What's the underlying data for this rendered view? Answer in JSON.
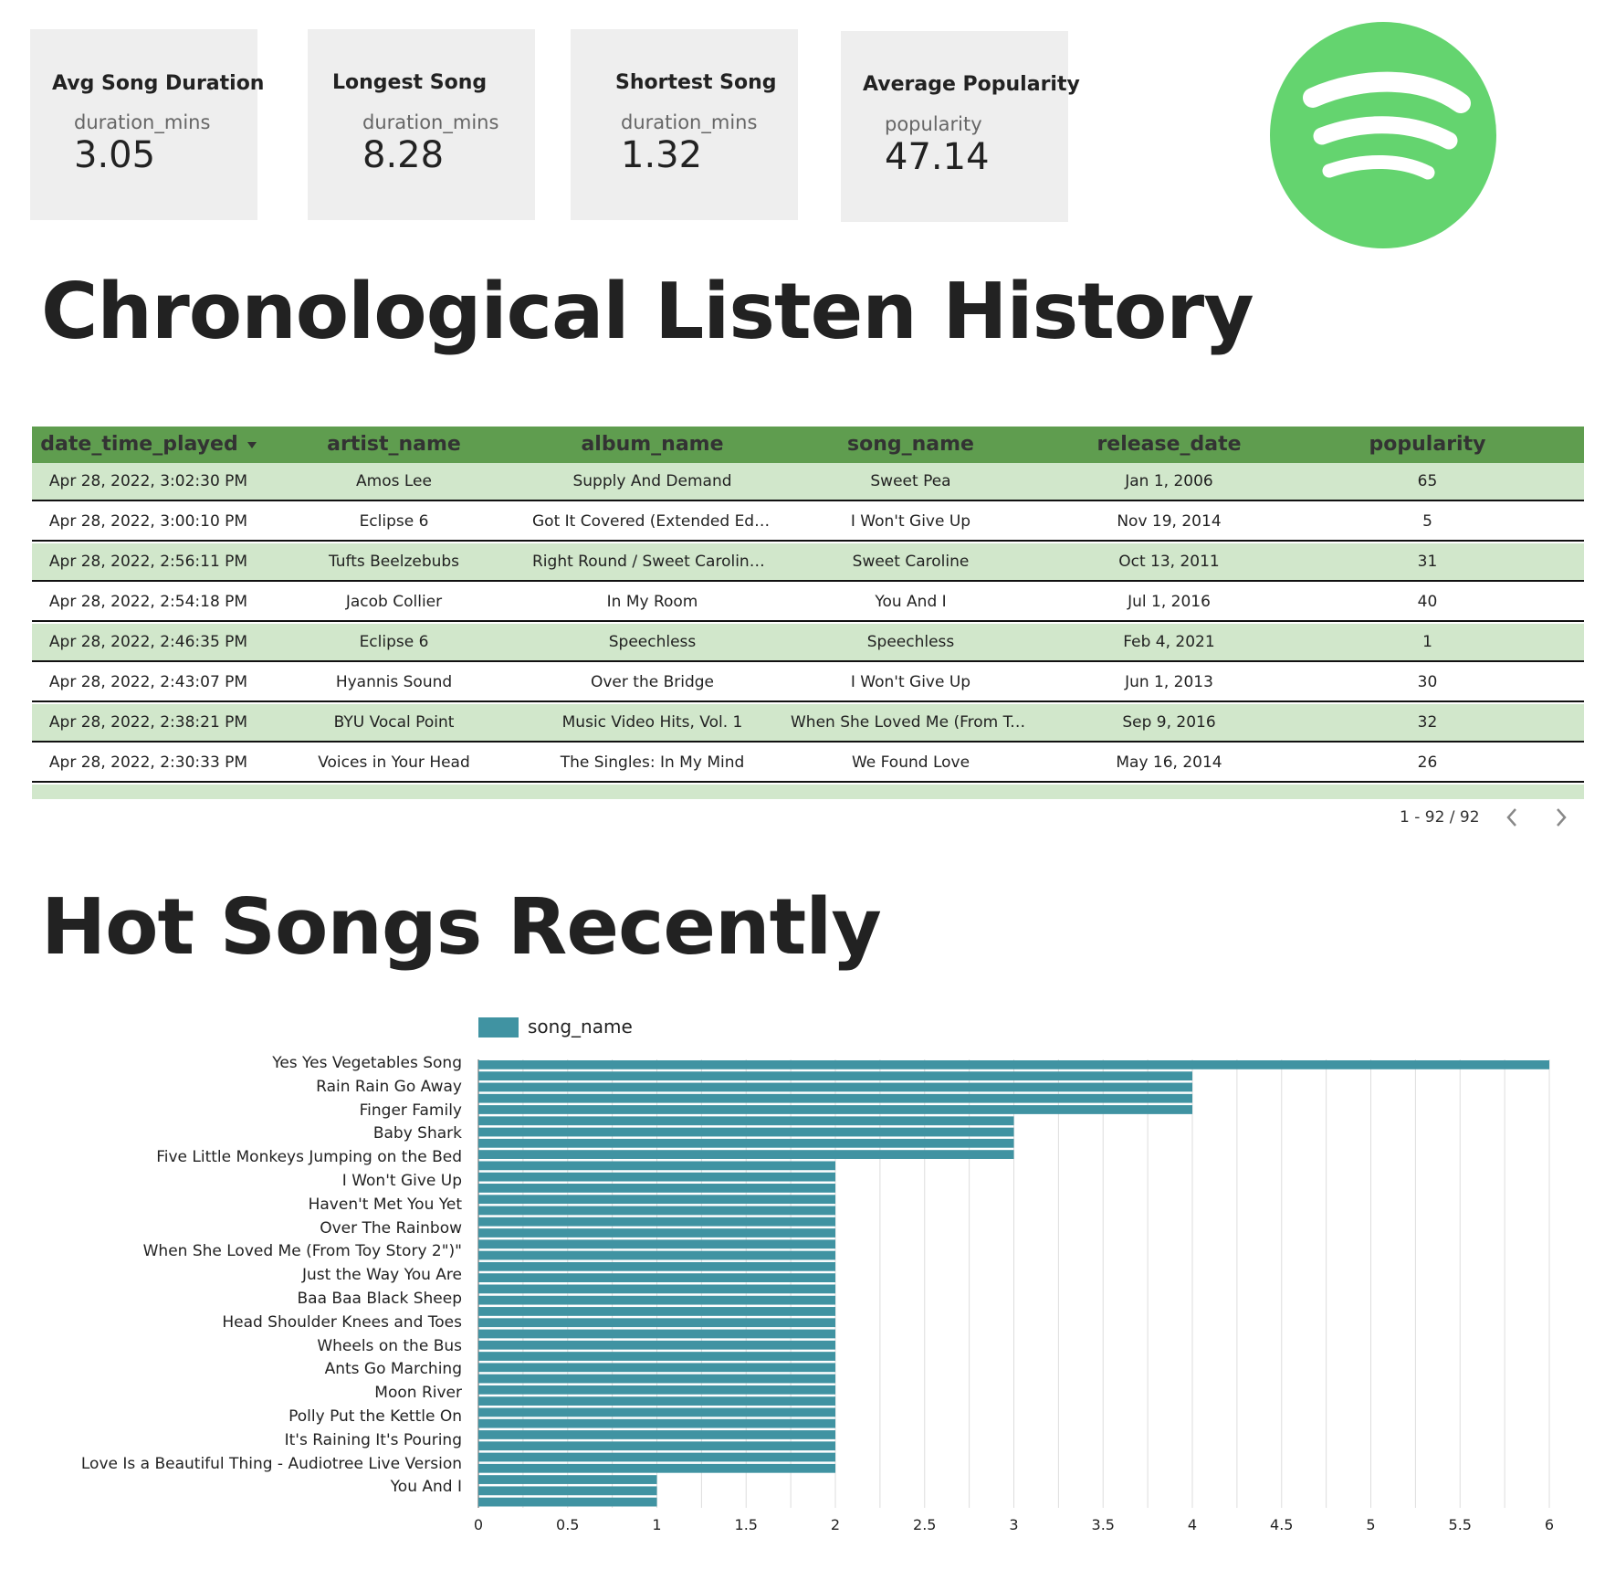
{
  "kpis": [
    {
      "title": "Avg Song Duration",
      "label": "duration_mins",
      "value": "3.05"
    },
    {
      "title": "Longest Song",
      "label": "duration_mins",
      "value": "8.28"
    },
    {
      "title": "Shortest Song",
      "label": "duration_mins",
      "value": "1.32"
    },
    {
      "title": "Average Popularity",
      "label": "popularity",
      "value": "47.14"
    }
  ],
  "logo": {
    "color": "#64d46f"
  },
  "history": {
    "title": "Chronological Listen History",
    "columns": [
      "date_time_played",
      "artist_name",
      "album_name",
      "song_name",
      "release_date",
      "popularity"
    ],
    "rows": [
      [
        "Apr 28, 2022, 3:02:30 PM",
        "Amos Lee",
        "Supply And Demand",
        "Sweet Pea",
        "Jan 1, 2006",
        "65"
      ],
      [
        "Apr 28, 2022, 3:00:10 PM",
        "Eclipse 6",
        "Got It Covered (Extended Editi…",
        "I Won't Give Up",
        "Nov 19, 2014",
        "5"
      ],
      [
        "Apr 28, 2022, 2:56:11 PM",
        "Tufts Beelzebubs",
        "Right Round / Sweet Caroline -…",
        "Sweet Caroline",
        "Oct 13, 2011",
        "31"
      ],
      [
        "Apr 28, 2022, 2:54:18 PM",
        "Jacob Collier",
        "In My Room",
        "You And I",
        "Jul 1, 2016",
        "40"
      ],
      [
        "Apr 28, 2022, 2:46:35 PM",
        "Eclipse 6",
        "Speechless",
        "Speechless",
        "Feb 4, 2021",
        "1"
      ],
      [
        "Apr 28, 2022, 2:43:07 PM",
        "Hyannis Sound",
        "Over the Bridge",
        "I Won't Give Up",
        "Jun 1, 2013",
        "30"
      ],
      [
        "Apr 28, 2022, 2:38:21 PM",
        "BYU Vocal Point",
        "Music Video Hits, Vol. 1",
        "When She Loved Me (From To…",
        "Sep 9, 2016",
        "32"
      ],
      [
        "Apr 28, 2022, 2:30:33 PM",
        "Voices in Your Head",
        "The Singles: In My Mind",
        "We Found Love",
        "May 16, 2014",
        "26"
      ]
    ],
    "pagination": "1 - 92 / 92"
  },
  "hot": {
    "title": "Hot Songs Recently"
  },
  "colors": {
    "header_green": "#5f9d4f",
    "row_green": "#d1e7cb",
    "bar": "#4093a2",
    "kpi_bg": "#eeeeee"
  },
  "chart_data": {
    "type": "bar",
    "orientation": "horizontal",
    "legend": "song_name",
    "legend_position": "top",
    "labels": [
      "Yes Yes Vegetables Song",
      "Rain Rain Go Away",
      "Finger Family",
      "Baby Shark",
      "Five Little Monkeys Jumping on the Bed",
      "I Won't Give Up",
      "Haven't Met You Yet",
      "Over The Rainbow",
      "When She Loved Me (From Toy Story 2\")\"",
      "Just the Way You Are",
      "Baa Baa Black Sheep",
      "Head Shoulder Knees and Toes",
      "Wheels on the Bus",
      "Ants Go Marching",
      "Moon River",
      "Polly Put the Kettle On",
      "It's Raining It's Pouring",
      "Love Is a Beautiful Thing - Audiotree Live Version",
      "You And I"
    ],
    "values": [
      6,
      4,
      4,
      4,
      4,
      3,
      3,
      3,
      3,
      2,
      2,
      2,
      2,
      2,
      2,
      2,
      2,
      2,
      2,
      2,
      2,
      2,
      2,
      2,
      2,
      2,
      2,
      2,
      2,
      2,
      2,
      2,
      2,
      2,
      2,
      2,
      2,
      1,
      1,
      1
    ],
    "x_ticks": [
      "0",
      "0.5",
      "1",
      "1.5",
      "2",
      "2.5",
      "3",
      "3.5",
      "4",
      "4.5",
      "5",
      "5.5",
      "6"
    ],
    "xlim": [
      0,
      6
    ],
    "grid": true
  }
}
